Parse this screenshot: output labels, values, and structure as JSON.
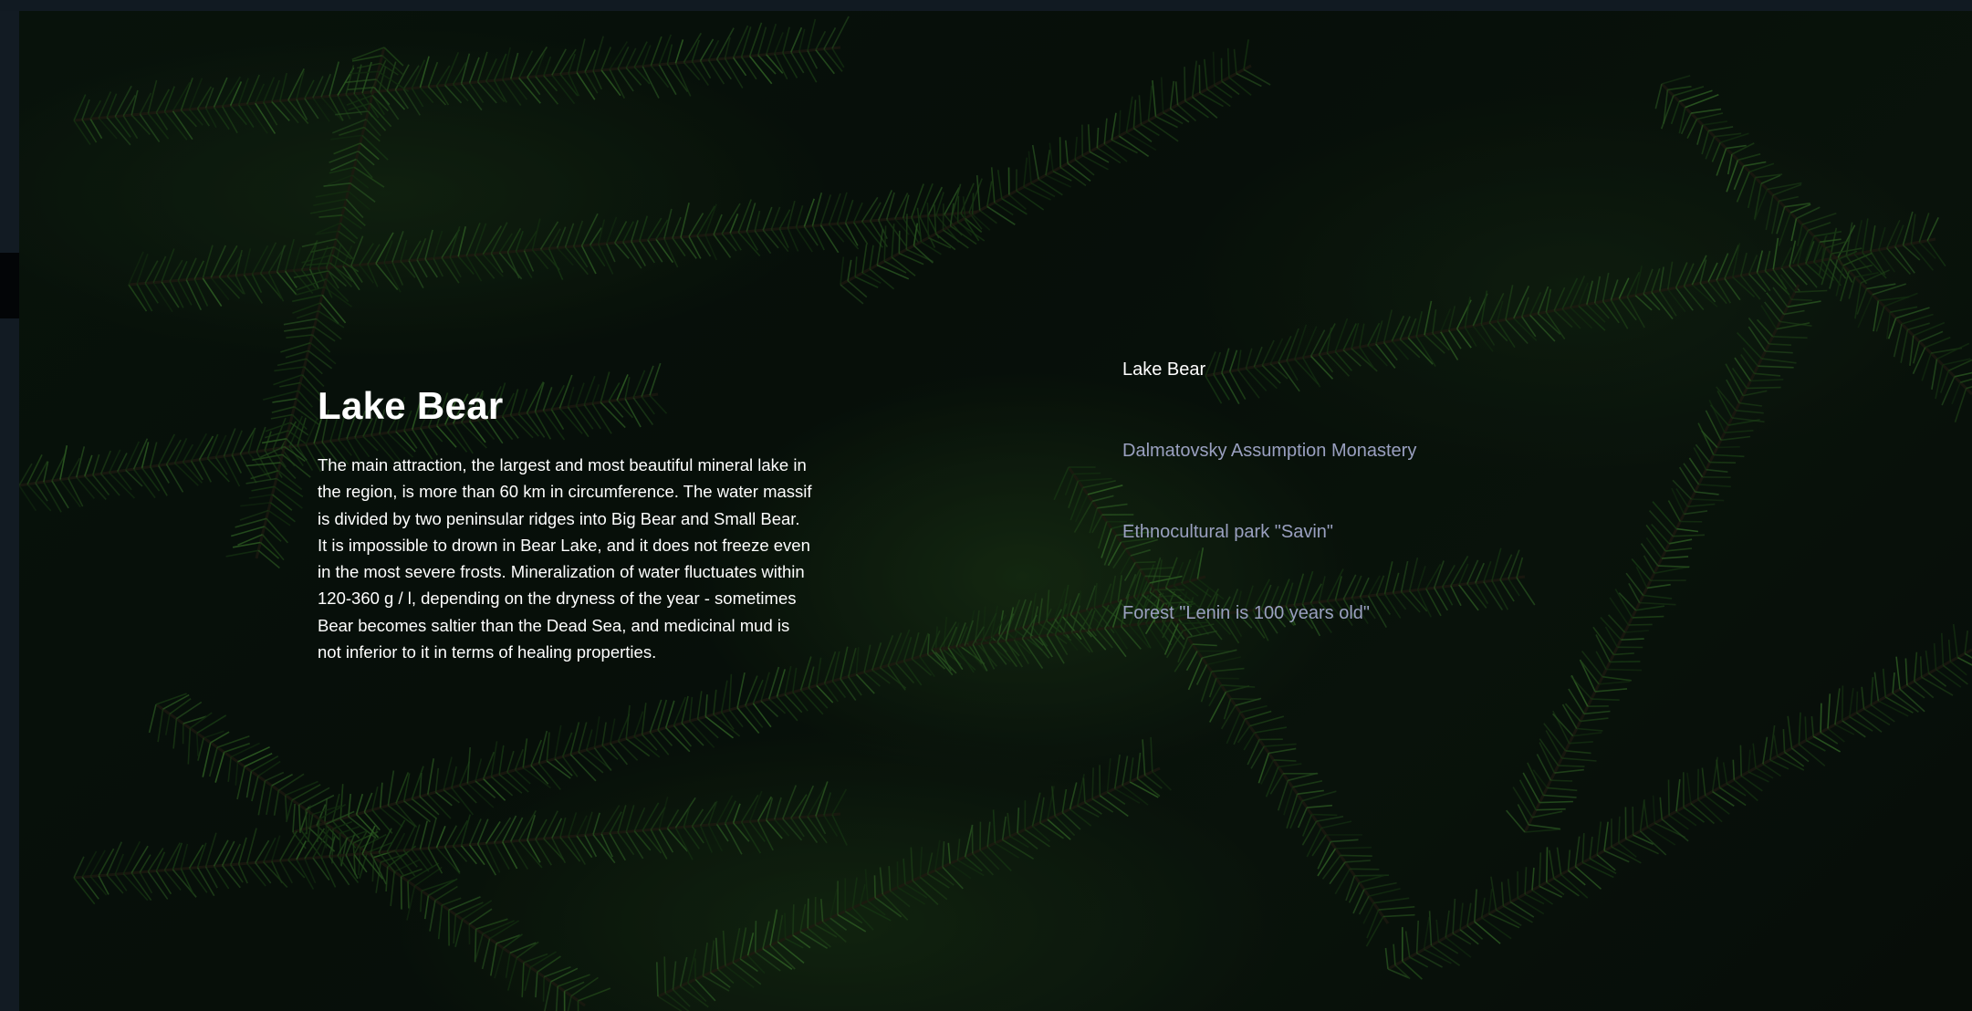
{
  "attraction": {
    "title": "Lake Bear",
    "paragraphs": [
      "The main attraction, the largest and most beautiful mineral lake in the region, is more than 60 km in circumference. The water massif is divided by two peninsular ridges into Big Bear and Small Bear.",
      "It is impossible to drown in Bear Lake, and it does not freeze even in the most severe frosts. Mineralization of water fluctuates within 120-360 g / l, depending on the dryness of the year - sometimes Bear becomes saltier than the Dead Sea, and medicinal mud is not inferior to it in terms of healing properties."
    ]
  },
  "places": [
    {
      "label": "Lake Bear",
      "active": true
    },
    {
      "label": "Dalmatovsky Assumption Monastery",
      "active": false
    },
    {
      "label": "Ethnocultural park \"Savin\"",
      "active": false
    },
    {
      "label": "Forest \"Lenin is 100 years old\"",
      "active": false
    }
  ],
  "colors": {
    "page_background": "#0f161e",
    "active_link": "#ffffff",
    "inactive_link": "#9aa0c0",
    "foliage": "#2f6a26"
  }
}
